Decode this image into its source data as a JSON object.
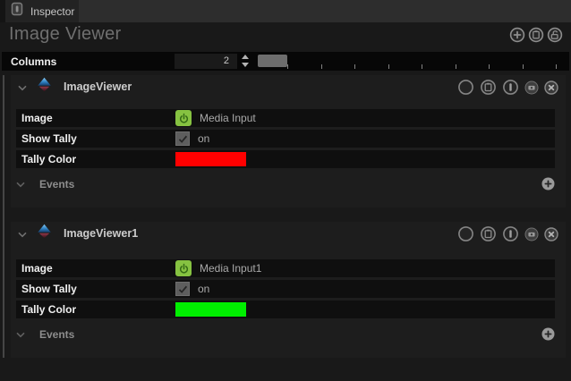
{
  "tab": {
    "label": "Inspector",
    "icon": "panel-icon"
  },
  "toolbar": {
    "title": "Image Viewer",
    "icons": [
      "add-icon",
      "paste-icon",
      "unlock-icon"
    ]
  },
  "columns_row": {
    "label": "Columns",
    "value": "2"
  },
  "sections": [
    {
      "title": "ImageViewer",
      "header_icons": [
        "circle-icon",
        "paste-icon",
        "bar-icon",
        "camera-icon",
        "close-icon"
      ],
      "properties": [
        {
          "label": "Image",
          "control": "power-toggle",
          "value": "Media Input"
        },
        {
          "label": "Show Tally",
          "control": "checkbox",
          "checked": true,
          "value": "on"
        },
        {
          "label": "Tally Color",
          "control": "color-swatch",
          "color": "#ff0000"
        }
      ],
      "events_label": "Events"
    },
    {
      "title": "ImageViewer1",
      "header_icons": [
        "circle-icon",
        "paste-icon",
        "bar-icon",
        "camera-icon",
        "close-icon"
      ],
      "properties": [
        {
          "label": "Image",
          "control": "power-toggle",
          "value": "Media Input1"
        },
        {
          "label": "Show Tally",
          "control": "checkbox",
          "checked": true,
          "value": "on"
        },
        {
          "label": "Tally Color",
          "control": "color-swatch",
          "color": "#00ee00"
        }
      ],
      "events_label": "Events"
    }
  ],
  "colors": {
    "power_button_green": "#86c241",
    "tally_red": "#ff0000",
    "tally_green": "#00ee00"
  }
}
